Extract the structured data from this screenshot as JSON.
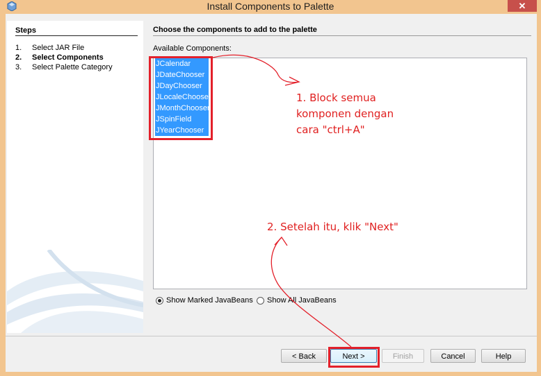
{
  "window": {
    "title": "Install Components to Palette",
    "close_glyph": "✕",
    "icon": "netbeans-icon"
  },
  "steps": {
    "title": "Steps",
    "items": [
      {
        "num": "1.",
        "label": "Select JAR File"
      },
      {
        "num": "2.",
        "label": "Select Components"
      },
      {
        "num": "3.",
        "label": "Select Palette Category"
      }
    ],
    "active_index": 1
  },
  "panel": {
    "title": "Choose the components to add to the palette",
    "available_label": "Available Components:",
    "components": [
      "JCalendar",
      "JDateChooser",
      "JDayChooser",
      "JLocaleChooser",
      "JMonthChooser",
      "JSpinField",
      "JYearChooser"
    ]
  },
  "radios": {
    "marked": "Show Marked JavaBeans",
    "all": "Show All JavaBeans",
    "selected": "marked"
  },
  "buttons": {
    "back": "< Back",
    "next": "Next >",
    "finish": "Finish",
    "cancel": "Cancel",
    "help": "Help"
  },
  "annotations": {
    "step1_lines": [
      "1. Block semua",
      "komponen dengan",
      "cara \"ctrl+A\""
    ],
    "step2": "2. Setelah itu, klik \"Next\"",
    "color": "#e3202a"
  }
}
